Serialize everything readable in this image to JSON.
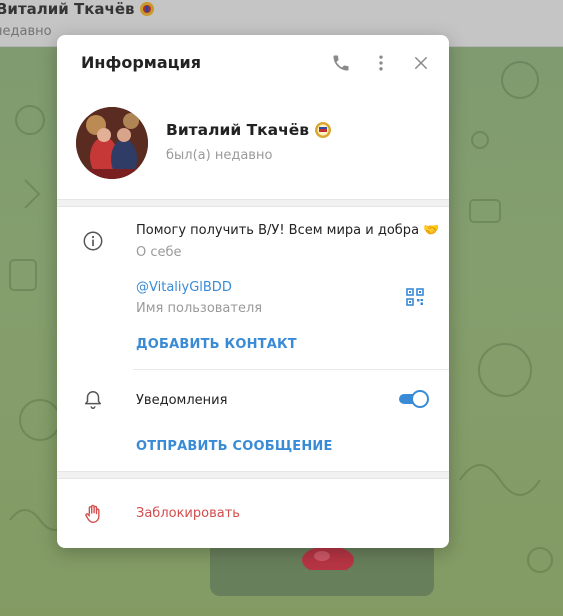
{
  "background": {
    "chat_title": "Виталий Ткачёв",
    "chat_status": "недавно"
  },
  "dialog": {
    "title": "Информация",
    "icons": {
      "call": "phone-icon",
      "menu": "more-vertical-icon",
      "close": "close-icon"
    }
  },
  "profile": {
    "name": "Виталий Ткачёв",
    "status": "был(а) недавно",
    "name_badge_icon": "emblem-badge-icon"
  },
  "info": {
    "bio": "Помогу получить В/У! Всем мира и добра 🤝",
    "bio_label": "О себе",
    "username": "@VitaliyGlBDD",
    "username_label": "Имя пользователя",
    "add_contact": "ДОБАВИТЬ КОНТАКТ"
  },
  "notifications": {
    "label": "Уведомления",
    "enabled": true,
    "send_message": "ОТПРАВИТЬ СООБЩЕНИЕ"
  },
  "block": {
    "label": "Заблокировать"
  },
  "colors": {
    "accent": "#3a8bd6",
    "danger": "#d44d4d",
    "muted": "#9a9a9a"
  }
}
